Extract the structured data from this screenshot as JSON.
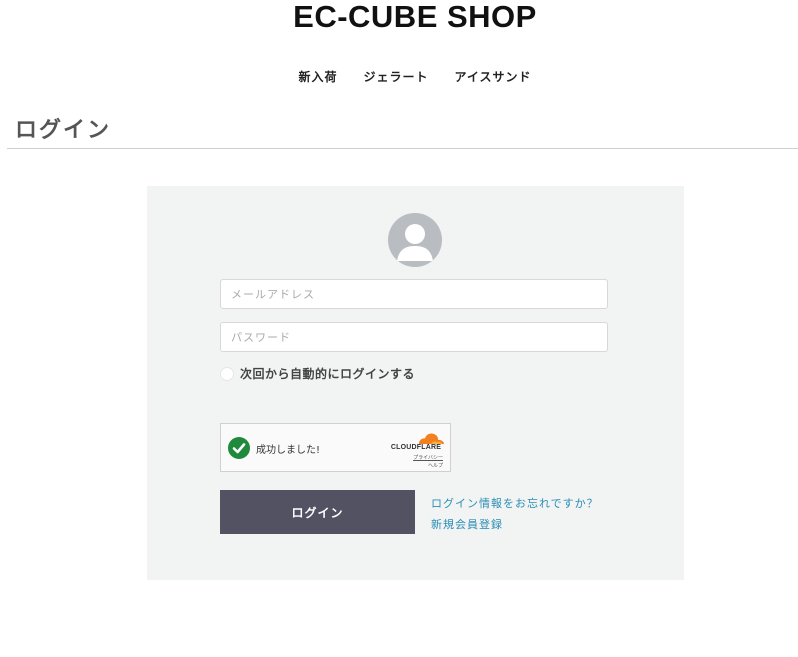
{
  "header": {
    "shop_title": "EC-CUBE SHOP"
  },
  "nav": {
    "items": [
      {
        "label": "新入荷"
      },
      {
        "label": "ジェラート"
      },
      {
        "label": "アイスサンド"
      }
    ]
  },
  "page": {
    "heading": "ログイン"
  },
  "login_form": {
    "email_placeholder": "メールアドレス",
    "email_value": "",
    "password_placeholder": "パスワード",
    "password_value": "",
    "remember_label": "次回から自動的にログインする",
    "remember_checked": false,
    "captcha": {
      "status_text": "成功しました!",
      "brand": "CLOUDFLARE",
      "privacy_label": "プライバシー",
      "terms_label": "ヘルプ",
      "status_icon": "check-circle-icon",
      "status_color": "#1f8a3b",
      "brand_color": "#f38020"
    },
    "submit_label": "ログイン",
    "forgot_link": "ログイン情報をお忘れですか？",
    "register_link": "新規会員登録"
  },
  "colors": {
    "panel_bg": "#f2f3f3",
    "button_bg": "#525263",
    "link": "#2b8db5",
    "avatar": "#b9bcc1"
  }
}
